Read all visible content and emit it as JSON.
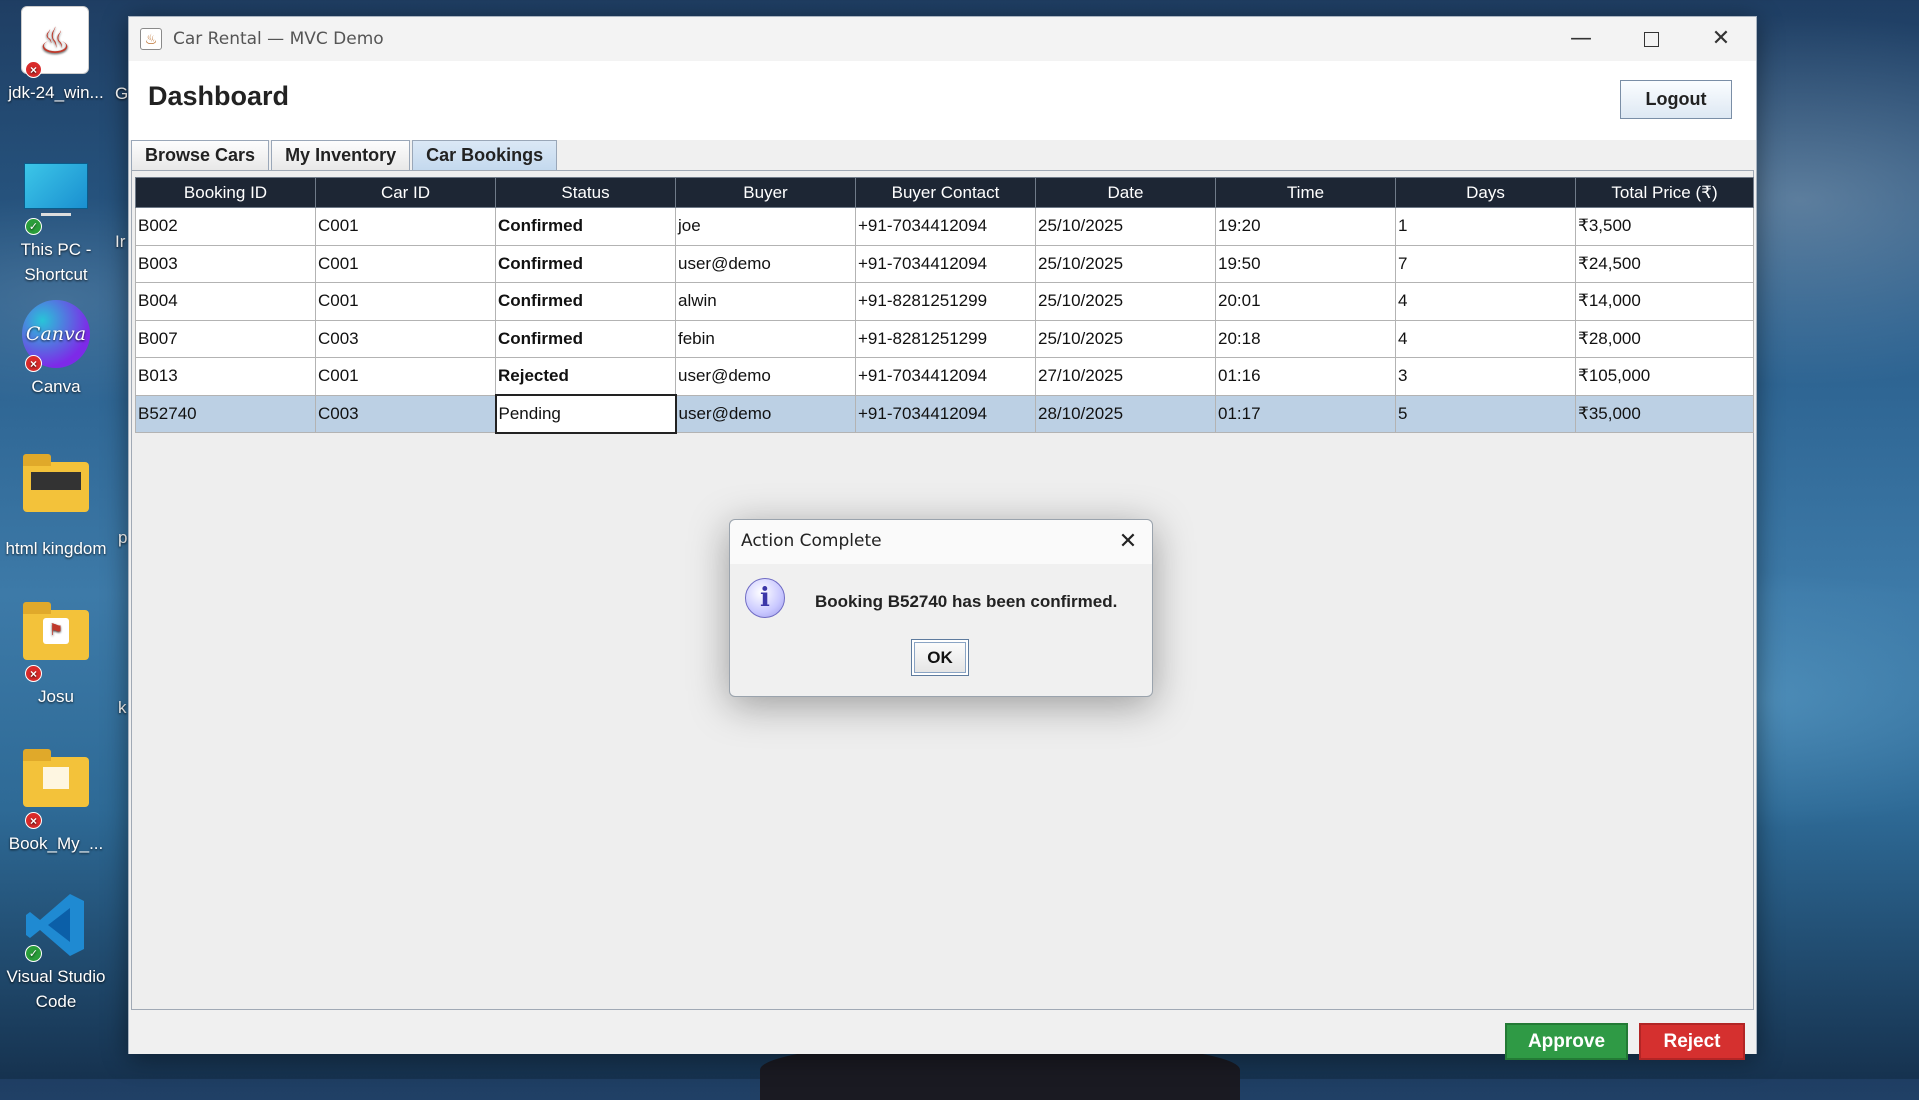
{
  "desktop": {
    "icons": [
      {
        "label": "jdk-24_win...",
        "badge": "error"
      },
      {
        "label": "This PC - Shortcut",
        "badge": "ok"
      },
      {
        "label": "Canva",
        "badge": "error"
      },
      {
        "label": "html kingdom",
        "badge": "cloud"
      },
      {
        "label": "Josu",
        "badge": "error"
      },
      {
        "label": "Book_My_...",
        "badge": "error"
      },
      {
        "label": "Visual Studio Code",
        "badge": "ok"
      }
    ],
    "canva_logo_text": "Canva"
  },
  "window": {
    "title": "Car Rental — MVC Demo",
    "controls": {
      "minimize": "—",
      "maximize": "",
      "close": "✕"
    }
  },
  "header": {
    "title": "Dashboard",
    "logout_label": "Logout"
  },
  "tabs": [
    {
      "label": "Browse Cars",
      "active": false
    },
    {
      "label": "My Inventory",
      "active": false
    },
    {
      "label": "Car Bookings",
      "active": true
    }
  ],
  "table": {
    "columns": [
      "Booking ID",
      "Car ID",
      "Status",
      "Buyer",
      "Buyer Contact",
      "Date",
      "Time",
      "Days",
      "Total Price (₹)"
    ],
    "rows": [
      {
        "booking_id": "B002",
        "car_id": "C001",
        "status": "Confirmed",
        "buyer": "joe",
        "contact": "+91-7034412094",
        "date": "25/10/2025",
        "time": "19:20",
        "days": "1",
        "price": "₹3,500"
      },
      {
        "booking_id": "B003",
        "car_id": "C001",
        "status": "Confirmed",
        "buyer": "user@demo",
        "contact": "+91-7034412094",
        "date": "25/10/2025",
        "time": "19:50",
        "days": "7",
        "price": "₹24,500"
      },
      {
        "booking_id": "B004",
        "car_id": "C001",
        "status": "Confirmed",
        "buyer": "alwin",
        "contact": "+91-8281251299",
        "date": "25/10/2025",
        "time": "20:01",
        "days": "4",
        "price": "₹14,000"
      },
      {
        "booking_id": "B007",
        "car_id": "C003",
        "status": "Confirmed",
        "buyer": "febin",
        "contact": "+91-8281251299",
        "date": "25/10/2025",
        "time": "20:18",
        "days": "4",
        "price": "₹28,000"
      },
      {
        "booking_id": "B013",
        "car_id": "C001",
        "status": "Rejected",
        "buyer": "user@demo",
        "contact": "+91-7034412094",
        "date": "27/10/2025",
        "time": "01:16",
        "days": "3",
        "price": "₹105,000"
      },
      {
        "booking_id": "B52740",
        "car_id": "C003",
        "status": "Pending",
        "buyer": "user@demo",
        "contact": "+91-7034412094",
        "date": "28/10/2025",
        "time": "01:17",
        "days": "5",
        "price": "₹35,000"
      }
    ],
    "selected_row_index": 5
  },
  "footer": {
    "approve_label": "Approve",
    "reject_label": "Reject"
  },
  "dialog": {
    "title": "Action Complete",
    "close": "✕",
    "icon": "i",
    "message": "Booking B52740 has been confirmed.",
    "ok_label": "OK"
  },
  "colors": {
    "confirmed": "#2e9a40",
    "rejected": "#d32a2a",
    "approve": "#2f9a45",
    "reject": "#d5302f",
    "table_header": "#1d2634",
    "selected_row": "#bcd0e4"
  }
}
